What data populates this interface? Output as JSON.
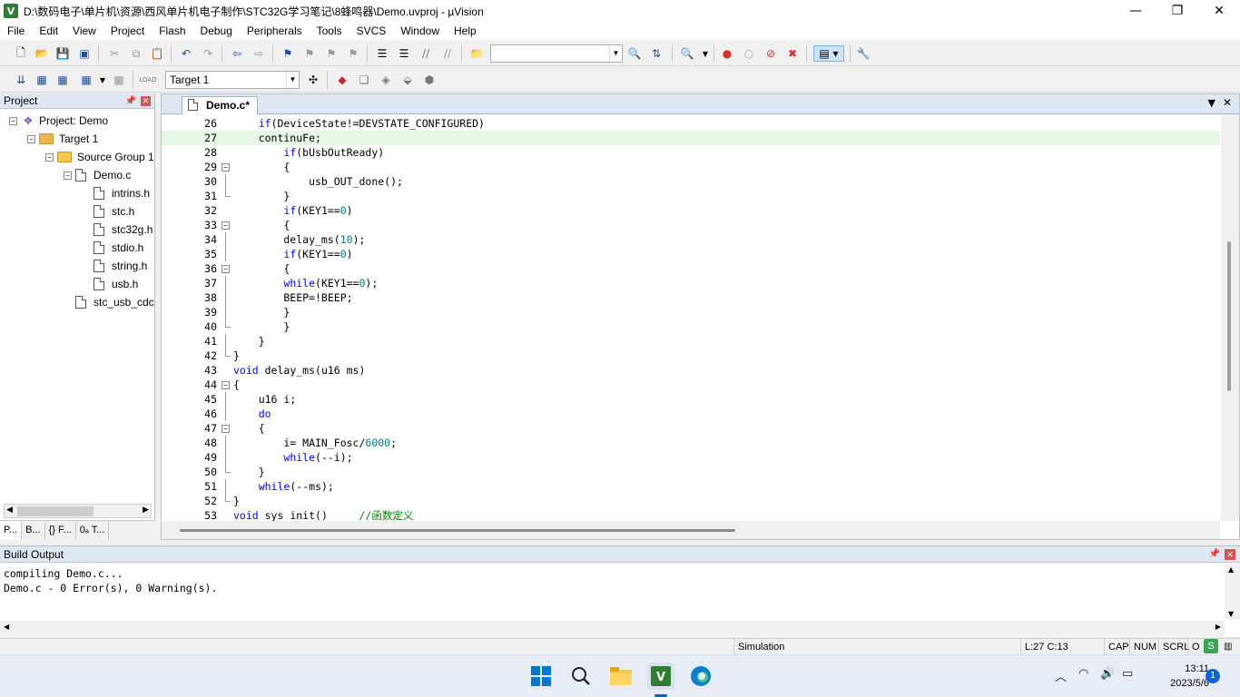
{
  "window": {
    "title": "D:\\数码电子\\单片机\\资源\\西风单片机电子制作\\STC32G学习笔记\\8蜂鸣器\\Demo.uvproj - µVision",
    "min": "—",
    "max": "❐",
    "close": "✕"
  },
  "menu": [
    "File",
    "Edit",
    "View",
    "Project",
    "Flash",
    "Debug",
    "Peripherals",
    "Tools",
    "SVCS",
    "Window",
    "Help"
  ],
  "toolbar2": {
    "target": "Target 1",
    "load_label": "LOAD"
  },
  "project_panel": {
    "title": "Project",
    "tree": [
      {
        "label": "Project: Demo",
        "level": 0,
        "kind": "project",
        "exp": "−"
      },
      {
        "label": "Target 1",
        "level": 1,
        "kind": "target",
        "exp": "−"
      },
      {
        "label": "Source Group 1",
        "level": 2,
        "kind": "folder",
        "exp": "−"
      },
      {
        "label": "Demo.c",
        "level": 3,
        "kind": "file",
        "exp": "−"
      },
      {
        "label": "intrins.h",
        "level": 4,
        "kind": "file"
      },
      {
        "label": "stc.h",
        "level": 4,
        "kind": "file"
      },
      {
        "label": "stc32g.h",
        "level": 4,
        "kind": "file"
      },
      {
        "label": "stdio.h",
        "level": 4,
        "kind": "file"
      },
      {
        "label": "string.h",
        "level": 4,
        "kind": "file"
      },
      {
        "label": "usb.h",
        "level": 4,
        "kind": "file"
      },
      {
        "label": "stc_usb_cdc",
        "level": 3,
        "kind": "file"
      }
    ],
    "tabs": [
      "P...",
      "B...",
      "{} F...",
      "0ₐ T..."
    ]
  },
  "editor": {
    "tab": "Demo.c*",
    "current_line": 27,
    "lines": [
      {
        "n": 26,
        "t": "    <k>if</k>(DeviceState!=DEVSTATE_CONFIGURED)"
      },
      {
        "n": 27,
        "t": "    continuFe;"
      },
      {
        "n": 28,
        "t": "        <k>if</k>(bUsbOutReady)"
      },
      {
        "n": 29,
        "t": "        {",
        "f": "box"
      },
      {
        "n": 30,
        "t": "            usb_OUT_done();",
        "f": "line"
      },
      {
        "n": 31,
        "t": "        }",
        "f": "end"
      },
      {
        "n": 32,
        "t": "        <k>if</k>(KEY1==<n>0</n>)"
      },
      {
        "n": 33,
        "t": "        {",
        "f": "box"
      },
      {
        "n": 34,
        "t": "        delay_ms(<n>10</n>);",
        "f": "line"
      },
      {
        "n": 35,
        "t": "        <k>if</k>(KEY1==<n>0</n>)",
        "f": "line"
      },
      {
        "n": 36,
        "t": "        {",
        "f": "box"
      },
      {
        "n": 37,
        "t": "        <k>while</k>(KEY1==<n>0</n>);",
        "f": "line"
      },
      {
        "n": 38,
        "t": "        BEEP=!BEEP;",
        "f": "line"
      },
      {
        "n": 39,
        "t": "        }",
        "f": "line"
      },
      {
        "n": 40,
        "t": "        }",
        "f": "end"
      },
      {
        "n": 41,
        "t": "    }",
        "f": "line"
      },
      {
        "n": 42,
        "t": "}",
        "f": "end"
      },
      {
        "n": 43,
        "t": "<k>void</k> delay_ms(u16 ms)"
      },
      {
        "n": 44,
        "t": "{",
        "f": "box"
      },
      {
        "n": 45,
        "t": "    u16 i;",
        "f": "line"
      },
      {
        "n": 46,
        "t": "    <k>do</k>",
        "f": "line"
      },
      {
        "n": 47,
        "t": "    {",
        "f": "box"
      },
      {
        "n": 48,
        "t": "        i= MAIN_Fosc/<n>6000</n>;",
        "f": "line"
      },
      {
        "n": 49,
        "t": "        <k>while</k>(--i);",
        "f": "line"
      },
      {
        "n": 50,
        "t": "    }",
        "f": "end"
      },
      {
        "n": 51,
        "t": "    <k>while</k>(--ms);",
        "f": "line"
      },
      {
        "n": 52,
        "t": "}",
        "f": "end"
      },
      {
        "n": 53,
        "t": "<k>void</k> sys init()     <c>//函数定义</c>"
      }
    ]
  },
  "build_output": {
    "title": "Build Output",
    "lines": [
      "compiling Demo.c...",
      "Demo.c - 0 Error(s), 0 Warning(s)."
    ]
  },
  "status": {
    "mode": "Simulation",
    "pos": "L:27 C:13",
    "caps": "CAP",
    "num": "NUM",
    "scrl": "SCRL",
    "ovr": "O"
  },
  "taskbar": {
    "time": "13:11",
    "date": "2023/5/6",
    "notif": "1"
  },
  "colors": {
    "keyword": "#0000ff",
    "number": "#008080",
    "comment": "#008000",
    "current_line": "#e7f7e7"
  }
}
